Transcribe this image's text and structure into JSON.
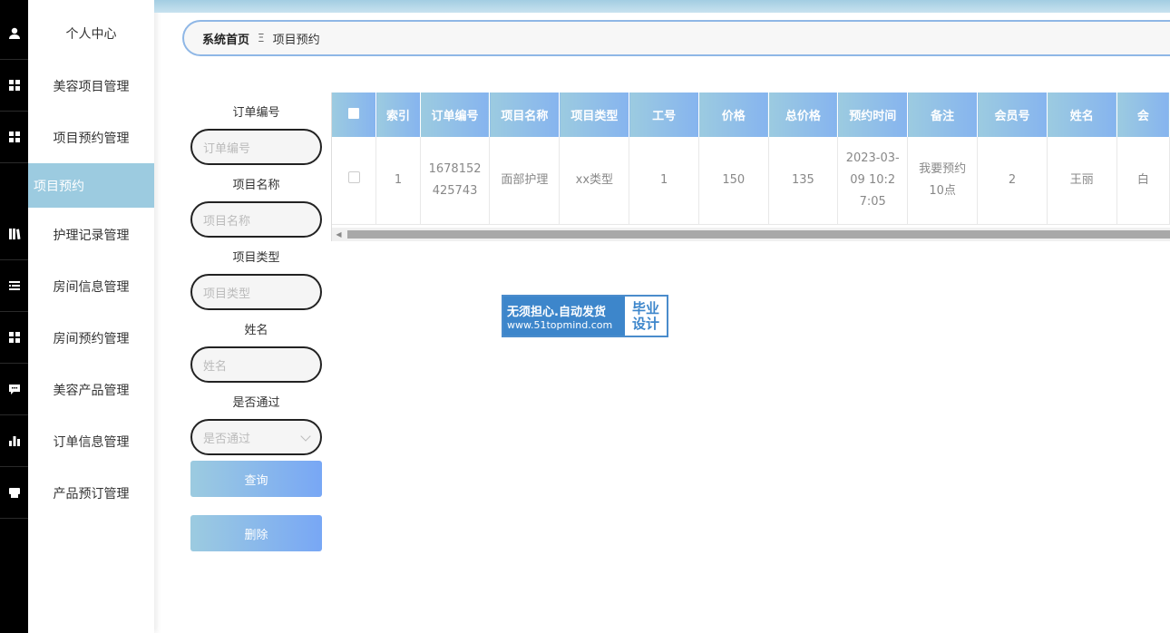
{
  "sidebar": {
    "items": [
      {
        "label": "个人中心",
        "icon": "user-icon"
      },
      {
        "label": "美容项目管理",
        "icon": "grid-icon"
      },
      {
        "label": "项目预约管理",
        "icon": "grid-icon"
      },
      {
        "label": "护理记录管理",
        "icon": "book-icon"
      },
      {
        "label": "房间信息管理",
        "icon": "list-icon"
      },
      {
        "label": "房间预约管理",
        "icon": "grid-icon"
      },
      {
        "label": "美容产品管理",
        "icon": "chat-icon"
      },
      {
        "label": "订单信息管理",
        "icon": "bar-chart-icon"
      },
      {
        "label": "产品预订管理",
        "icon": "printer-icon"
      }
    ],
    "active_sub": "项目预约"
  },
  "breadcrumb": {
    "home": "系统首页",
    "separator": "Ξ",
    "current": "项目预约"
  },
  "search": {
    "order_no": {
      "label": "订单编号",
      "placeholder": "订单编号"
    },
    "project_name": {
      "label": "项目名称",
      "placeholder": "项目名称"
    },
    "project_type": {
      "label": "项目类型",
      "placeholder": "项目类型"
    },
    "name": {
      "label": "姓名",
      "placeholder": "姓名"
    },
    "approved": {
      "label": "是否通过",
      "placeholder": "是否通过"
    },
    "query_label": "查询",
    "delete_label": "删除"
  },
  "table": {
    "headers": [
      "索引",
      "订单编号",
      "项目名称",
      "项目类型",
      "工号",
      "价格",
      "总价格",
      "预约时间",
      "备注",
      "会员号",
      "姓名",
      "会"
    ],
    "rows": [
      [
        "1",
        "1678152425743",
        "面部护理",
        "xx类型",
        "1",
        "150",
        "135",
        "2023-03-09 10:27:05",
        "我要预约10点",
        "2",
        "王丽",
        "白"
      ]
    ]
  },
  "watermark": {
    "line1": "无须担心.自动发货",
    "line2": "www.51topmind.com",
    "right1": "毕业",
    "right2": "设计"
  },
  "colors": {
    "accent": "#9ccbe0",
    "button_end": "#78a7f5",
    "sidebar_bg": "#000000"
  }
}
